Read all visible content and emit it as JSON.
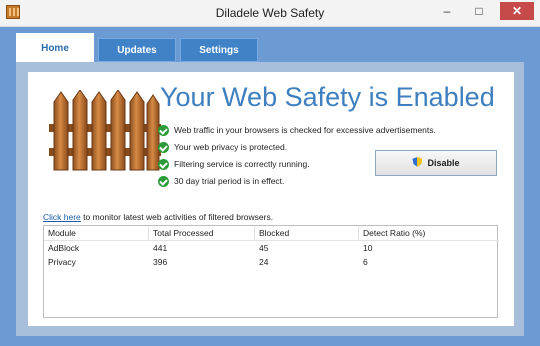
{
  "window": {
    "title": "Diladele Web Safety"
  },
  "tabs": [
    {
      "label": "Home"
    },
    {
      "label": "Updates"
    },
    {
      "label": "Settings"
    }
  ],
  "main": {
    "headline": "Your Web Safety is Enabled",
    "status_items": [
      "Web traffic in your browsers is checked for excessive advertisements.",
      "Your web privacy is protected.",
      "Filtering service is correctly running.",
      "30 day trial period is in effect."
    ],
    "disable_label": "Disable",
    "monitor_link": "Click here",
    "monitor_text": " to monitor latest web activities of filtered browsers."
  },
  "table": {
    "headers": [
      "Module",
      "Total Processed",
      "Blocked",
      "Detect Ratio (%)"
    ],
    "rows": [
      [
        "AdBlock",
        "441",
        "45",
        "10"
      ],
      [
        "Privacy",
        "396",
        "24",
        "6"
      ]
    ]
  }
}
